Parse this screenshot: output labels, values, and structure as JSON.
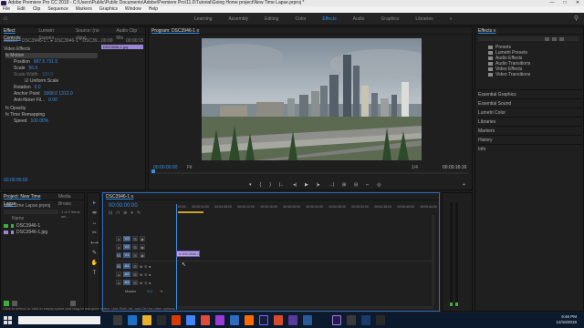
{
  "window": {
    "title": "Adobe Premiere Pro CC 2019 - C:\\Users\\Public\\Public Documents\\Adobe\\Premiere Pro\\11.0\\Tutorial\\Going Home project\\New Time Lapse.prproj *",
    "controls": [
      "—",
      "□",
      "✕"
    ]
  },
  "menu": [
    "File",
    "Edit",
    "Clip",
    "Sequence",
    "Markers",
    "Graphics",
    "Window",
    "Help"
  ],
  "workspaces": {
    "tabs": [
      "Learning",
      "Assembly",
      "Editing",
      "Color",
      "Effects",
      "Audio",
      "Graphics",
      "Libraries"
    ],
    "active": "Effects",
    "more": "»"
  },
  "effect_controls": {
    "tabs": [
      "Effect Controls",
      "Lumetri Scopes",
      "Source: (no clips)",
      "Audio Clip Mix"
    ],
    "header": "Master * DSC3946-1... ▸ DSC3946-1 * DSC39...",
    "clip_label": "DSC3946-1.jpg",
    "ruler": [
      "00:00",
      "00:00:15"
    ],
    "section_video": "Video Effects",
    "rows": [
      {
        "name": "fx  Motion",
        "value": "",
        "sel": true
      },
      {
        "name": "Position",
        "value": "987.5    731.5"
      },
      {
        "name": "Scale",
        "value": "56.0"
      },
      {
        "name": "Scale Width",
        "value": "100.0"
      },
      {
        "name": "",
        "value": "☑ Uniform Scale"
      },
      {
        "name": "Rotation",
        "value": "0.0"
      },
      {
        "name": "Anchor Point",
        "value": "1968.0  1312.0"
      },
      {
        "name": "Anti-flicker Fil...",
        "value": "0.00"
      },
      {
        "name": "fx  Opacity",
        "value": ""
      },
      {
        "name": "fx  Time Remapping",
        "value": ""
      },
      {
        "name": "Speed",
        "value": "100.00%"
      }
    ],
    "timecode": "00:00:00:00"
  },
  "program": {
    "title": "Program: DSC3946-1 ≡",
    "timecode_left": "00:00:00:00",
    "fit": "Fit",
    "fraction": "1/4",
    "timecode_right": "00:00:16:16",
    "controls": [
      "▾",
      "{",
      "}",
      "|←",
      "◂|",
      "▶",
      "|▸",
      "→|",
      "⊞",
      "⊟",
      "⌐",
      "◎",
      "+"
    ]
  },
  "effects": {
    "title": "Effects ≡",
    "tree": [
      "Presets",
      "Lumetri Presets",
      "Audio Effects",
      "Audio Transitions",
      "Video Effects",
      "Video Transitions"
    ],
    "sections": [
      "Essential Graphics",
      "Essential Sound",
      "Lumetri Color",
      "Libraries",
      "Markers",
      "History",
      "Info"
    ]
  },
  "project": {
    "tabs": [
      "Project: New Time Lapse",
      "Media Brows"
    ],
    "file": "New Time Lapse.prproj",
    "count": "1 of 2 items sel...",
    "column": "Name",
    "items": [
      {
        "name": "DSC3946-1",
        "color": "#3fae3f"
      },
      {
        "name": "DSC3946-1.jpg",
        "color": "#9b86d6"
      }
    ]
  },
  "tools": [
    "▸",
    "⇹",
    "↔",
    "✂",
    "⟷",
    "✎",
    "✋",
    "T"
  ],
  "timeline": {
    "title": "DSC3946-1 ≡",
    "timecode": "00:00:00:00",
    "ticks": [
      "00:00",
      "00:00:04:00",
      "00:00:08:00",
      "00:00:12:00",
      "00:00:16:00",
      "00:00:20:00",
      "00:00:24:00",
      "00:00:28:00",
      "00:00:32:00",
      "00:00:36:00",
      "00:00:40:00",
      "00:00:44:00"
    ],
    "video_tracks": [
      {
        "id": "V3",
        "label": "V3"
      },
      {
        "id": "V2",
        "label": "V2"
      },
      {
        "id": "V1",
        "label": "V1"
      }
    ],
    "audio_tracks": [
      {
        "id": "A1",
        "label": "A1",
        "mute": "M",
        "solo": "S"
      },
      {
        "id": "A2",
        "label": "A2",
        "mute": "M",
        "solo": "S"
      },
      {
        "id": "A3",
        "label": "A3",
        "mute": "M",
        "solo": "S"
      }
    ],
    "master": "Master",
    "master_val": "0.0",
    "clip": "fx DSC3946-1"
  },
  "status": "Click to select, or click in empty space and drag to marquee select. Use Shift, Alt, and Ctrl for other options.",
  "taskbar": {
    "time": "9:46 PM",
    "date": "12/16/2019"
  }
}
